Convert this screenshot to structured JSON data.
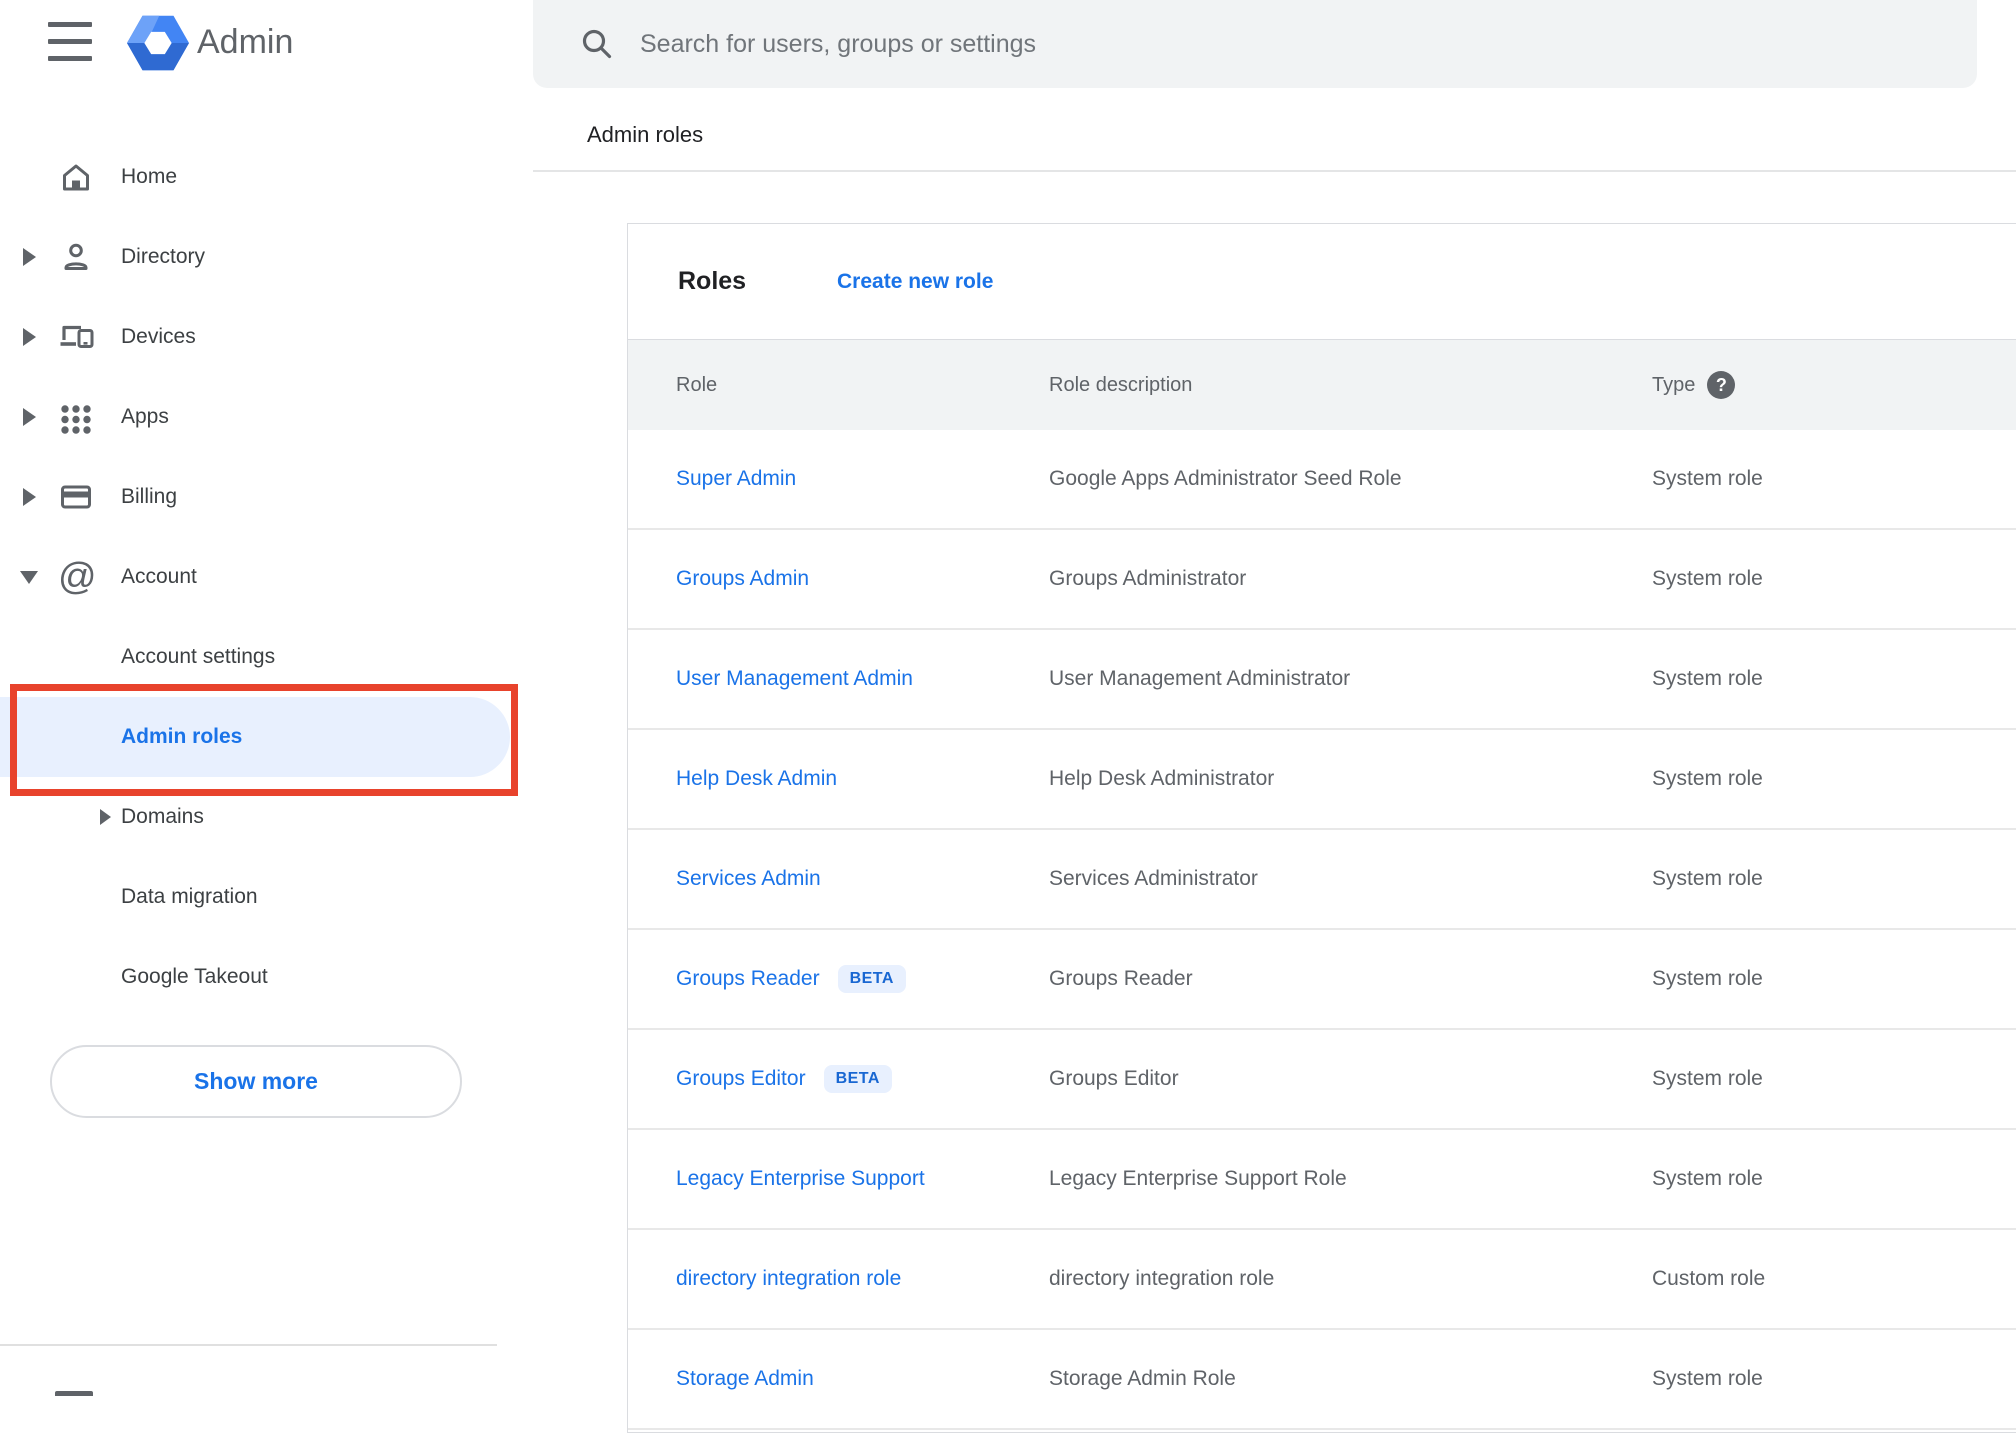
{
  "app": {
    "brand": "Admin"
  },
  "search": {
    "placeholder": "Search for users, groups or settings"
  },
  "breadcrumb": {
    "label": "Admin roles"
  },
  "sidebar": {
    "items": [
      {
        "label": "Home"
      },
      {
        "label": "Directory"
      },
      {
        "label": "Devices"
      },
      {
        "label": "Apps"
      },
      {
        "label": "Billing"
      },
      {
        "label": "Account"
      },
      {
        "label": "Account settings"
      },
      {
        "label": "Admin roles",
        "selected": true
      },
      {
        "label": "Domains"
      },
      {
        "label": "Data migration"
      },
      {
        "label": "Google Takeout"
      }
    ],
    "show_more": "Show more"
  },
  "main": {
    "title": "Roles",
    "create_link": "Create new role",
    "table": {
      "columns": {
        "role": "Role",
        "description": "Role description",
        "type": "Type"
      },
      "rows": [
        {
          "role": "Super Admin",
          "description": "Google Apps Administrator Seed Role",
          "type": "System role"
        },
        {
          "role": "Groups Admin",
          "description": "Groups Administrator",
          "type": "System role"
        },
        {
          "role": "User Management Admin",
          "description": "User Management Administrator",
          "type": "System role"
        },
        {
          "role": "Help Desk Admin",
          "description": "Help Desk Administrator",
          "type": "System role"
        },
        {
          "role": "Services Admin",
          "description": "Services Administrator",
          "type": "System role"
        },
        {
          "role": "Groups Reader",
          "badge": "BETA",
          "description": "Groups Reader",
          "type": "System role"
        },
        {
          "role": "Groups Editor",
          "badge": "BETA",
          "description": "Groups Editor",
          "type": "System role"
        },
        {
          "role": "Legacy Enterprise Support",
          "description": "Legacy Enterprise Support Role",
          "type": "System role"
        },
        {
          "role": "directory integration role",
          "description": "directory integration role",
          "type": "Custom role"
        },
        {
          "role": "Storage Admin",
          "description": "Storage Admin Role",
          "type": "System role"
        }
      ]
    }
  },
  "colors": {
    "link_blue": "#1a73e8",
    "selected_item_bg": "#e8f0fe",
    "annotation_red": "#e8432c",
    "beta_badge_bg": "#e8f0fe",
    "beta_badge_text": "#1967d2",
    "search_bg": "#f1f3f4",
    "table_header_bg": "#f1f3f4"
  }
}
